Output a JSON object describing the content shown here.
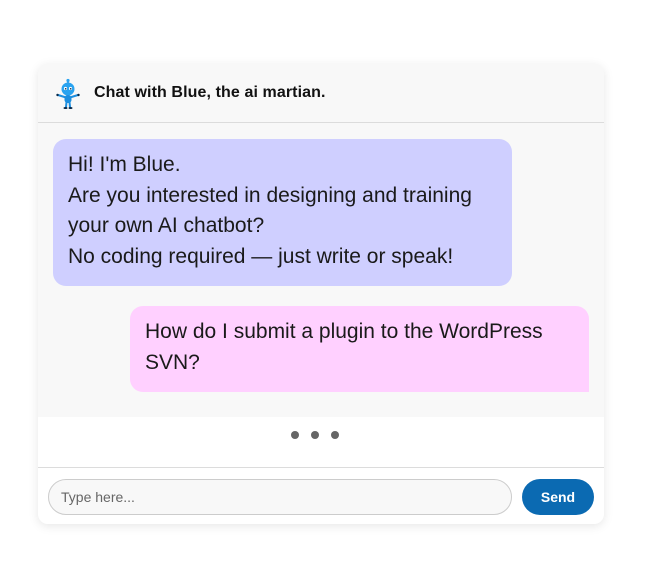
{
  "header": {
    "title": "Chat with Blue, the ai martian.",
    "avatar_icon": "martian-avatar-icon"
  },
  "messages": [
    {
      "role": "bot",
      "lines": [
        "Hi! I'm Blue.",
        "Are you interested in designing and training",
        "your own AI chatbot?",
        "No coding required — just write or speak!"
      ],
      "color": "#cfcfff"
    },
    {
      "role": "user",
      "lines": [
        "How do I submit a plugin to the WordPress",
        "SVN?"
      ],
      "color": "#ffd0ff"
    }
  ],
  "typing_indicator": {
    "icon": "typing-dots-icon",
    "dot_count": 3
  },
  "input": {
    "value": "",
    "placeholder": "Type here..."
  },
  "send_button": {
    "label": "Send",
    "color": "#0b6ab2"
  }
}
